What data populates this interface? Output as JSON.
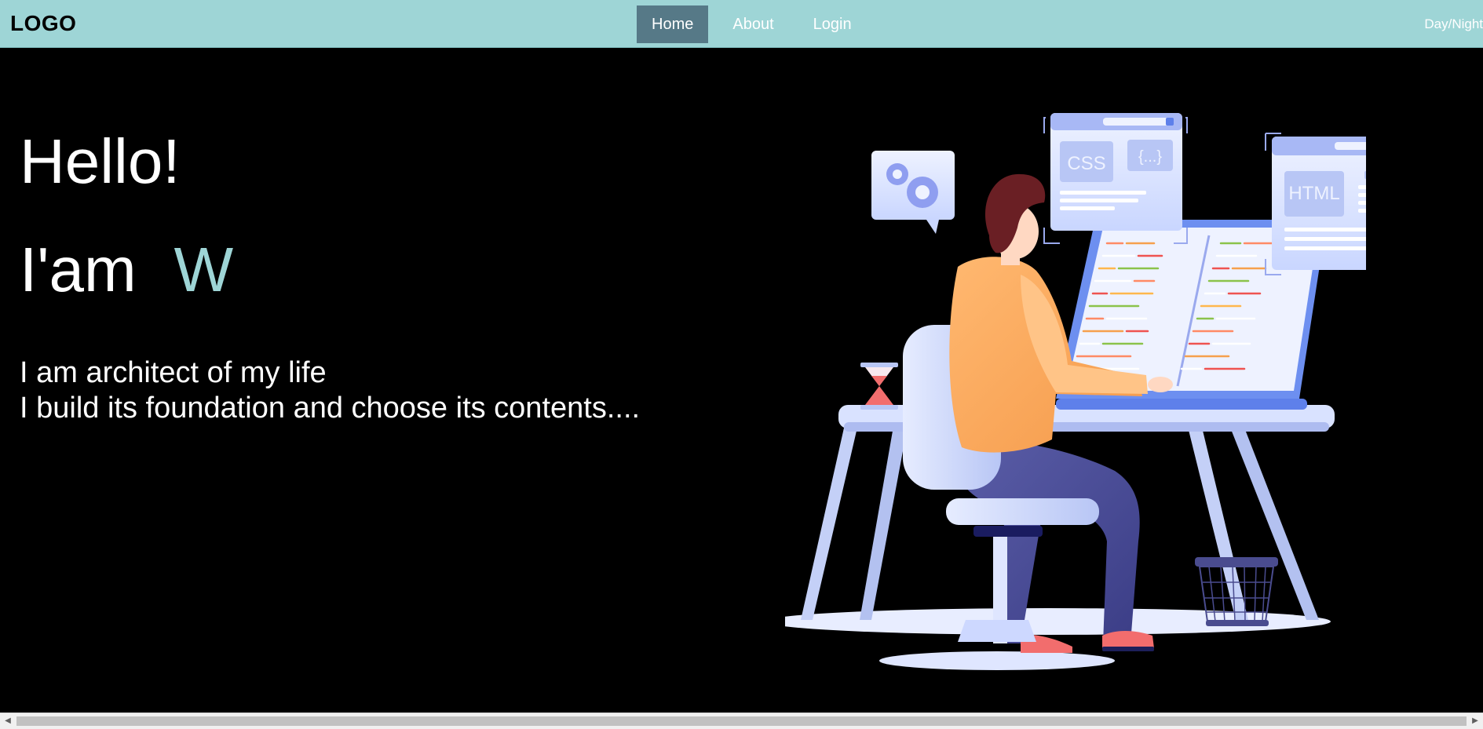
{
  "header": {
    "logo": "LOGO",
    "nav": [
      {
        "label": "Home",
        "active": true
      },
      {
        "label": "About",
        "active": false
      },
      {
        "label": "Login",
        "active": false
      }
    ],
    "theme_toggle": "Day/Night"
  },
  "hero": {
    "greeting": "Hello!",
    "intro_prefix": "I'am",
    "typed_text": "W",
    "bio_line1": "I am architect of my life",
    "bio_line2": "I build its foundation and choose its contents...."
  },
  "illustration": {
    "css_card_label": "CSS",
    "braces_label": "{...}",
    "html_card_label": "HTML"
  },
  "colors": {
    "header_bg": "#9ed5d6",
    "nav_active_bg": "#567987",
    "accent": "#9ed5d6",
    "page_bg": "#000000"
  },
  "icons": {
    "scroll_left": "triangle-left-icon",
    "scroll_right": "triangle-right-icon",
    "gears": "gear-icon"
  }
}
